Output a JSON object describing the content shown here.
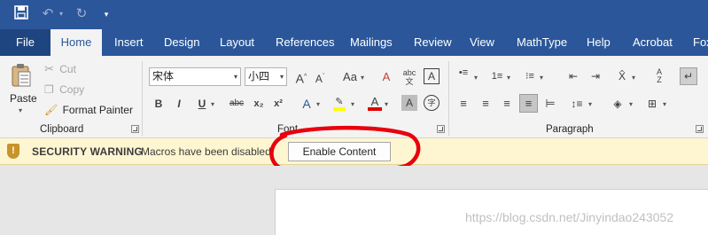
{
  "qat": {
    "icons": [
      "save-icon",
      "undo-icon",
      "redo-icon",
      "customize-qat-icon"
    ]
  },
  "tabs": [
    {
      "label": "File"
    },
    {
      "label": "Home",
      "active": true
    },
    {
      "label": "Insert"
    },
    {
      "label": "Design"
    },
    {
      "label": "Layout"
    },
    {
      "label": "References"
    },
    {
      "label": "Mailings"
    },
    {
      "label": "Review"
    },
    {
      "label": "View"
    },
    {
      "label": "MathType"
    },
    {
      "label": "Help"
    },
    {
      "label": "Acrobat"
    },
    {
      "label": "Fox"
    }
  ],
  "ribbon": {
    "clipboard": {
      "paste": "Paste",
      "cut": "Cut",
      "copy": "Copy",
      "format_painter": "Format Painter",
      "group_label": "Clipboard"
    },
    "font": {
      "font_name": "宋体",
      "font_size": "小四",
      "group_label": "Font",
      "buttons": [
        "B",
        "I",
        "U",
        "abc",
        "x₂",
        "x²"
      ]
    },
    "paragraph": {
      "group_label": "Paragraph"
    }
  },
  "security_bar": {
    "title": "SECURITY WARNING",
    "message": "Macros have been disabled.",
    "button": "Enable Content",
    "annotation_color": "#e8000d"
  },
  "watermark": "https://blog.csdn.net/Jinyindao243052",
  "colors": {
    "brand": "#2b579a",
    "tab_active_text": "#2b579a",
    "warning_bar": "#fdf6d1",
    "highlight_yellow": "#ffff00",
    "font_red": "#e00000"
  }
}
